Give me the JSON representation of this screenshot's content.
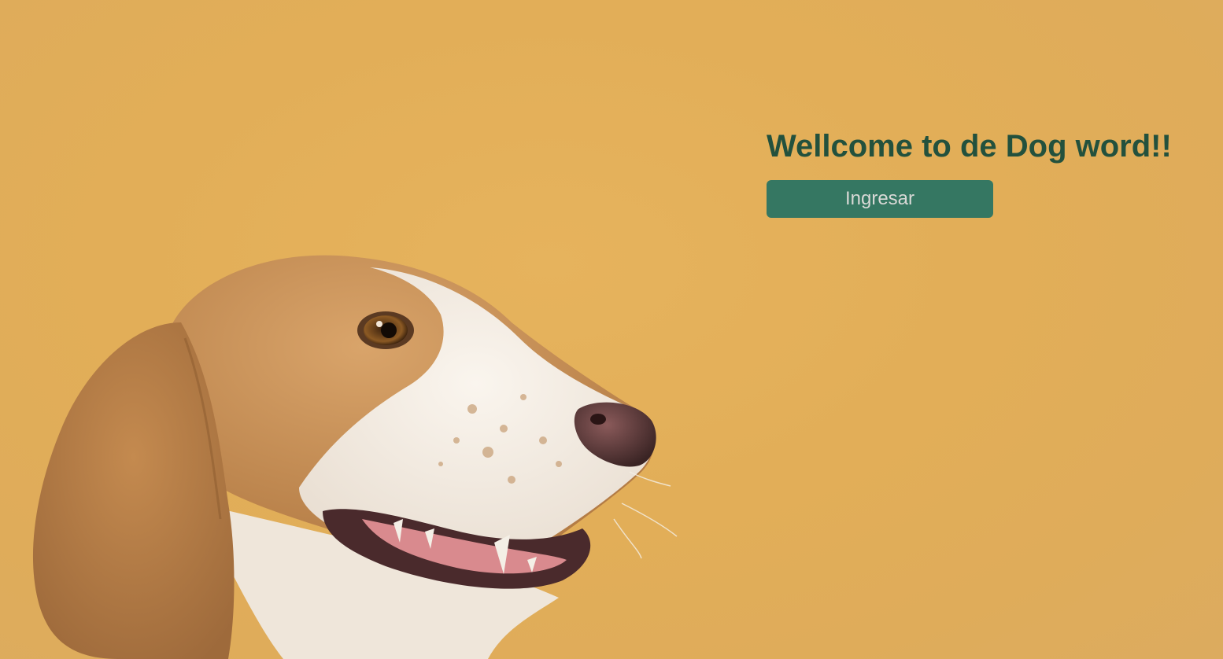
{
  "welcome": {
    "title": "Wellcome to de Dog word!!",
    "button_label": "Ingresar"
  },
  "hero": {
    "subject": "beagle-dog-portrait"
  },
  "colors": {
    "background": "#e2ae58",
    "title": "#23513d",
    "button_bg": "#357762",
    "button_text": "#d9d9d6"
  }
}
